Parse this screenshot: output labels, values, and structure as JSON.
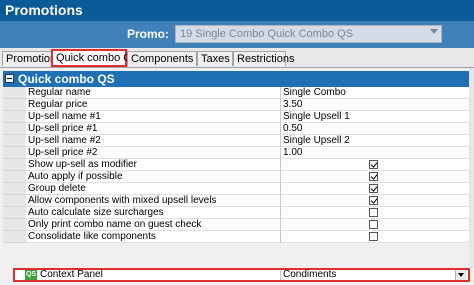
{
  "window": {
    "title": "Promotions"
  },
  "promo": {
    "label": "Promo:",
    "value": "19 Single Combo Quick Combo QS"
  },
  "tabs": [
    {
      "label": "Promotion"
    },
    {
      "label": "Quick combo QS"
    },
    {
      "label": "Components QS"
    },
    {
      "label": "Taxes"
    },
    {
      "label": "Restrictions"
    }
  ],
  "section": {
    "title": "Quick combo QS"
  },
  "rows": [
    {
      "name": "Regular name",
      "value": "Single Combo"
    },
    {
      "name": "Regular price",
      "value": "3.50"
    },
    {
      "name": "Up-sell name #1",
      "value": "Single Upsell 1"
    },
    {
      "name": "Up-sell price #1",
      "value": "0.50"
    },
    {
      "name": "Up-sell name #2",
      "value": "Single Upsell 2"
    },
    {
      "name": "Up-sell price #2",
      "value": "1.00"
    },
    {
      "name": "Show up-sell as modifier",
      "checked": true
    },
    {
      "name": "Auto apply if possible",
      "checked": true
    },
    {
      "name": "Group delete",
      "checked": true
    },
    {
      "name": "Allow components with mixed upsell levels",
      "checked": true
    },
    {
      "name": "Auto calculate size surcharges",
      "checked": false
    },
    {
      "name": "Only print combo name on guest check",
      "checked": false
    },
    {
      "name": "Consolidate like components",
      "checked": false
    }
  ],
  "context_panel": {
    "icon_text": "QS",
    "label": "Context Panel",
    "value": "Condiments"
  }
}
